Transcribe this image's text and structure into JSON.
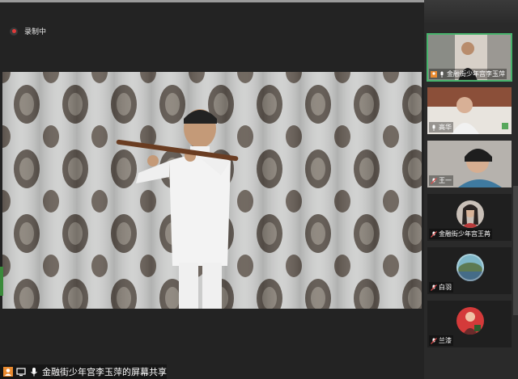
{
  "recording": {
    "label": "录制中"
  },
  "screen_share": {
    "label": "金融街少年宫李玉萍的屏幕共享"
  },
  "participants": [
    {
      "name": "金融街少年宫李玉萍",
      "video": true,
      "active": true
    },
    {
      "name": "高华",
      "video": true,
      "active": false
    },
    {
      "name": "王一",
      "video": true,
      "active": false
    },
    {
      "name": "金融街少年宫王苒",
      "video": false,
      "active": false
    },
    {
      "name": "白羽",
      "video": false,
      "active": false
    },
    {
      "name": "兰漆",
      "video": false,
      "active": false
    }
  ],
  "colors": {
    "accent": "#47b36c",
    "recording": "#e03a3a",
    "background": "#232323"
  }
}
